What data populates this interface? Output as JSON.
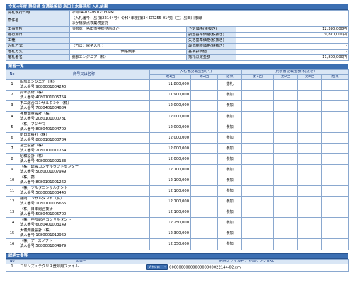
{
  "header": {
    "title": "令和4年度 静岡県 交通基盤部 島田土木事務所 入札結果"
  },
  "info": {
    "open_datetime_label": "開札執行日時",
    "open_datetime_value": "令和04-07-28 02:03 PM",
    "case_name_label": "案件名",
    "case_name_value_line1": "（入札番号：島 第22144号）令和4年度[第34-D7255-01号]（主）島田川根線",
    "case_name_value_line2": "ほか橋梁点検業務委託",
    "project_place_label": "工事箇所",
    "project_place_value": "川根本　島田市神座地内ほか",
    "planned_price_label": "予定価格(税抜き)",
    "planned_price_value": "12,390,000円",
    "period_label": "履行期日",
    "period_value": "",
    "survey_label": "調査基準価格(税抜き)",
    "survey_value": "9,870,000円",
    "work_type_label": "工種",
    "work_type_value": "",
    "lost_label": "失格基準価格(税抜き)",
    "lost_value": "-",
    "bid_method_label": "入札方式",
    "bid_method_value": "（方法：電子入札 ）",
    "min_price_label": "最低制限価格(税抜き)",
    "min_price_value": "-",
    "award_method_label": "落札方式",
    "award_method_value": "価格競争",
    "score_label": "基準評価値",
    "score_value": "-",
    "winner_label": "落札者名",
    "winner_value": "服部エンジニア（株）",
    "win_price_label": "落札決定金額",
    "win_price_value": "11,800,000円"
  },
  "bidders_section": {
    "title": "業者一覧"
  },
  "bidders_headers": {
    "no": "No",
    "name": "商号又は名称",
    "bid_amount": "入札書記載金額(円)",
    "first": "第1回",
    "second": "第2回",
    "result": "結果",
    "estimate_amount": "見積書記載金額(税抜き)",
    "est_first": "第1回",
    "est_second": "第2回",
    "est_third": "第3回",
    "est_result": "結果"
  },
  "bidders": [
    {
      "no": "1",
      "name": "服部エンジニア（株）",
      "corp": "法人番号 9080001004240",
      "first": "11,800,000",
      "second": "",
      "result": "落札"
    },
    {
      "no": "2",
      "name": "鈴木技研（株）",
      "corp": "法人番号 4080101005754",
      "first": "11,900,000",
      "second": "",
      "result": "参加"
    },
    {
      "no": "3",
      "name": "不二総合コンサルタント（株）",
      "corp": "法人番号 7080401004684",
      "first": "12,000,000",
      "second": "",
      "result": "参加"
    },
    {
      "no": "4",
      "name": "神東測量設計（株）",
      "corp": "法人番号 2080101000781",
      "first": "12,000,000",
      "second": "",
      "result": "参加"
    },
    {
      "no": "5",
      "name": "（株）フジヤマ",
      "corp": "法人番号 8080401004709",
      "first": "12,000,000",
      "second": "",
      "result": "参加"
    },
    {
      "no": "6",
      "name": "新日本設計（株）",
      "corp": "法人番号 8080101000784",
      "first": "12,000,000",
      "second": "",
      "result": "参加"
    },
    {
      "no": "7",
      "name": "富士設計（株）",
      "corp": "法人番号 2080101011754",
      "first": "12,000,000",
      "second": "",
      "result": "参加"
    },
    {
      "no": "8",
      "name": "昭和設計（株）",
      "corp": "法人番号 4080001002133",
      "first": "12,000,000",
      "second": "",
      "result": "参加"
    },
    {
      "no": "9",
      "name": "（株）建設コンサルタントセンター",
      "corp": "法人番号 5080001007949",
      "first": "12,100,000",
      "second": "",
      "result": "参加"
    },
    {
      "no": "10",
      "name": "（株）葵",
      "corp": "法人番号 8080101001262",
      "first": "12,100,000",
      "second": "",
      "result": "参加"
    },
    {
      "no": "11",
      "name": "（株）ツルタコンサルタント",
      "corp": "法人番号 5080001003440",
      "first": "12,100,000",
      "second": "",
      "result": "参加"
    },
    {
      "no": "12",
      "name": "静岡コンサルタント（株）",
      "corp": "法人番号 1080101005666",
      "first": "12,100,000",
      "second": "",
      "result": "参加"
    },
    {
      "no": "13",
      "name": "（株）日本総合技研",
      "corp": "法人番号 5080401005700",
      "first": "12,100,000",
      "second": "",
      "result": "参加"
    },
    {
      "no": "14",
      "name": "（株）中部総合コンサルタント",
      "corp": "法人番号 6080401003149",
      "first": "12,250,000",
      "second": "",
      "result": "参加"
    },
    {
      "no": "15",
      "name": "大儀測量設計（株）",
      "corp": "法人番号 1080001012969",
      "first": "12,300,000",
      "second": "",
      "result": "参加"
    },
    {
      "no": "16",
      "name": "（株）アースソフト",
      "corp": "法人番号 5080001004979",
      "first": "12,350,000",
      "second": "",
      "result": "参加"
    }
  ],
  "files_section": {
    "title": "説明文書等"
  },
  "files_headers": {
    "no": "No",
    "doc_name": "文書名",
    "file_name": "格納ファイル名／外部リンクURL"
  },
  "files": [
    {
      "no": "1",
      "doc_name": "コリンズ・テクリス登録用ファイル",
      "button": "ダウンロード",
      "file_name": "0000000000000000000022144-02.xml"
    }
  ]
}
